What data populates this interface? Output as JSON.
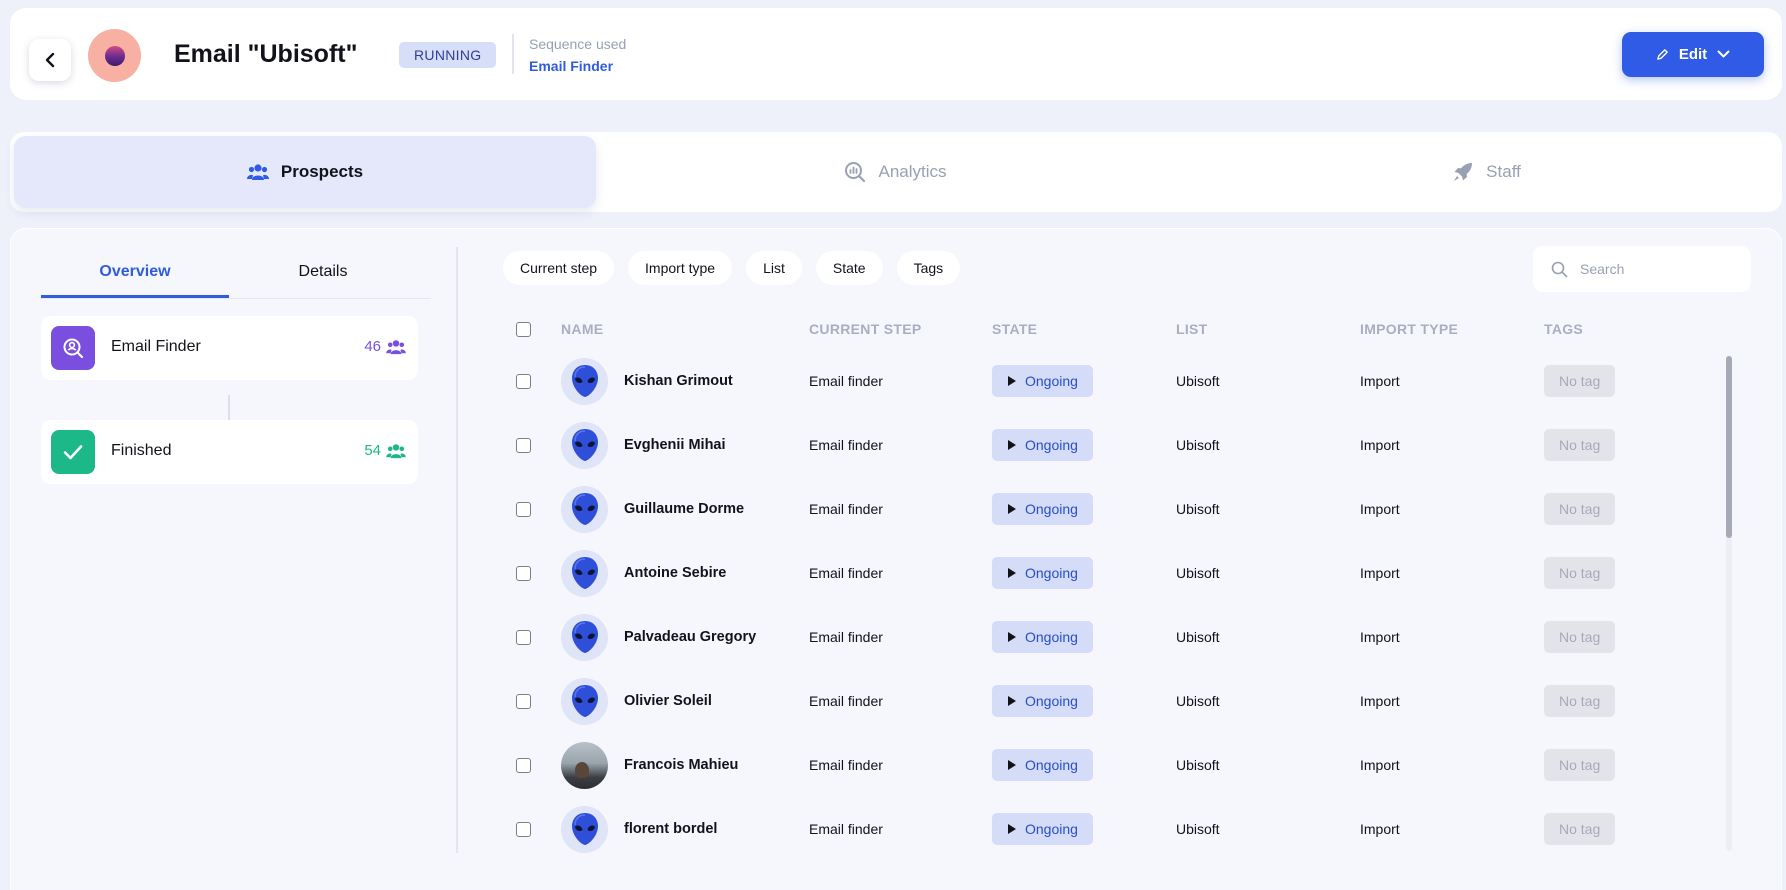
{
  "header": {
    "title": "Email \"Ubisoft\"",
    "status": "RUNNING",
    "sequence_label": "Sequence used",
    "sequence_value": "Email Finder",
    "edit_label": "Edit",
    "colors": {
      "accent": "#2f5be6",
      "status_bg": "#d7def8"
    }
  },
  "tabs": [
    {
      "label": "Prospects",
      "icon": "users-icon",
      "active": true
    },
    {
      "label": "Analytics",
      "icon": "analytics-search-icon",
      "active": false
    },
    {
      "label": "Staff",
      "icon": "rocket-icon",
      "active": false
    }
  ],
  "subtabs": [
    {
      "label": "Overview",
      "active": true
    },
    {
      "label": "Details",
      "active": false
    }
  ],
  "steps": [
    {
      "name": "Email Finder",
      "count": "46",
      "icon": "search-person-icon",
      "color": "#7a4fe0"
    },
    {
      "name": "Finished",
      "count": "54",
      "icon": "check-icon",
      "color": "#1cb887"
    }
  ],
  "filters": [
    "Current step",
    "Import type",
    "List",
    "State",
    "Tags"
  ],
  "search": {
    "placeholder": "Search"
  },
  "table": {
    "columns": [
      "NAME",
      "CURRENT STEP",
      "STATE",
      "LIST",
      "IMPORT TYPE",
      "TAGS"
    ],
    "rows": [
      {
        "name": "Kishan Grimout",
        "step": "Email finder",
        "state": "Ongoing",
        "list": "Ubisoft",
        "import": "Import",
        "tags": "No tag",
        "avatar": "alien"
      },
      {
        "name": "Evghenii Mihai",
        "step": "Email finder",
        "state": "Ongoing",
        "list": "Ubisoft",
        "import": "Import",
        "tags": "No tag",
        "avatar": "alien"
      },
      {
        "name": "Guillaume Dorme",
        "step": "Email finder",
        "state": "Ongoing",
        "list": "Ubisoft",
        "import": "Import",
        "tags": "No tag",
        "avatar": "alien"
      },
      {
        "name": "Antoine Sebire",
        "step": "Email finder",
        "state": "Ongoing",
        "list": "Ubisoft",
        "import": "Import",
        "tags": "No tag",
        "avatar": "alien"
      },
      {
        "name": "Palvadeau Gregory",
        "step": "Email finder",
        "state": "Ongoing",
        "list": "Ubisoft",
        "import": "Import",
        "tags": "No tag",
        "avatar": "alien"
      },
      {
        "name": "Olivier Soleil",
        "step": "Email finder",
        "state": "Ongoing",
        "list": "Ubisoft",
        "import": "Import",
        "tags": "No tag",
        "avatar": "alien"
      },
      {
        "name": "Francois Mahieu",
        "step": "Email finder",
        "state": "Ongoing",
        "list": "Ubisoft",
        "import": "Import",
        "tags": "No tag",
        "avatar": "photo"
      },
      {
        "name": "florent bordel",
        "step": "Email finder",
        "state": "Ongoing",
        "list": "Ubisoft",
        "import": "Import",
        "tags": "No tag",
        "avatar": "alien"
      }
    ]
  }
}
